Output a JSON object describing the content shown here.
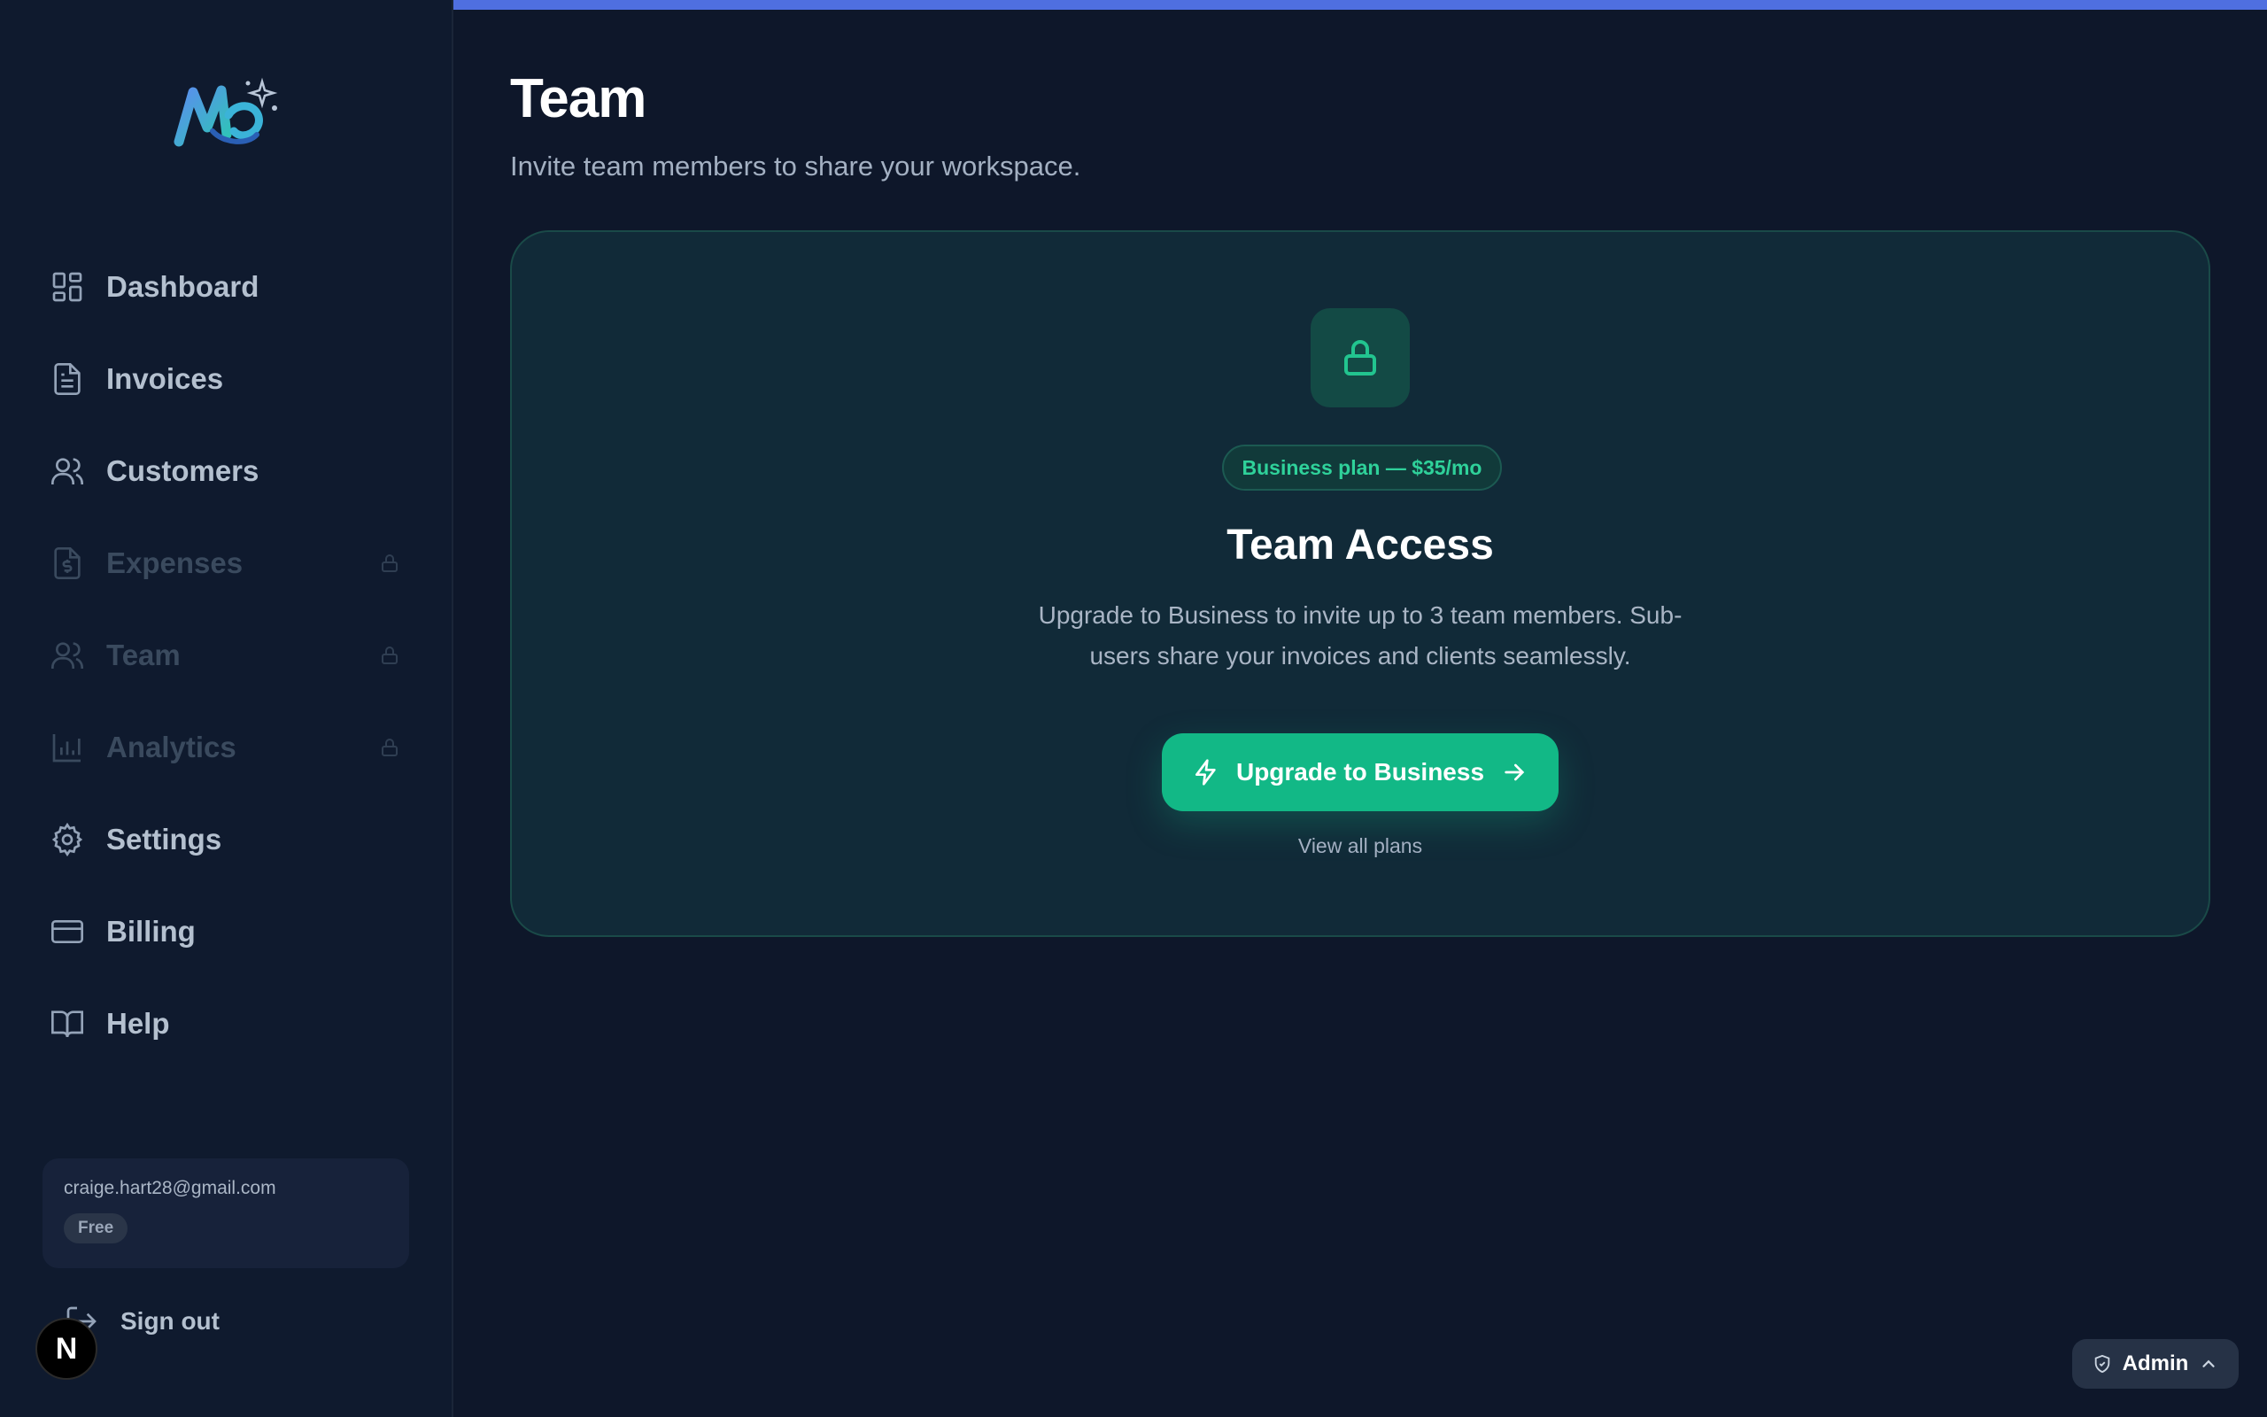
{
  "sidebar": {
    "logo": "mb-logo-icon",
    "items": [
      {
        "label": "Dashboard",
        "icon": "dashboard-icon",
        "locked": false
      },
      {
        "label": "Invoices",
        "icon": "file-text-icon",
        "locked": false
      },
      {
        "label": "Customers",
        "icon": "users-icon",
        "locked": false
      },
      {
        "label": "Expenses",
        "icon": "receipt-icon",
        "locked": true
      },
      {
        "label": "Team",
        "icon": "team-icon",
        "locked": true
      },
      {
        "label": "Analytics",
        "icon": "bar-chart-icon",
        "locked": true
      },
      {
        "label": "Settings",
        "icon": "gear-icon",
        "locked": false
      },
      {
        "label": "Billing",
        "icon": "credit-card-icon",
        "locked": false
      },
      {
        "label": "Help",
        "icon": "book-icon",
        "locked": false
      }
    ],
    "user": {
      "email": "craige.hart28@gmail.com",
      "plan": "Free"
    },
    "signout_label": "Sign out",
    "n_badge": "N"
  },
  "header": {
    "title": "Team",
    "subtitle": "Invite team members to share your workspace."
  },
  "card": {
    "plan_chip": "Business plan — $35/mo",
    "title": "Team Access",
    "description": "Upgrade to Business to invite up to 3 team members. Sub-users share your invoices and clients seamlessly.",
    "upgrade_label": "Upgrade to Business",
    "view_plans_label": "View all plans"
  },
  "admin_label": "Admin",
  "colors": {
    "accent": "#12b886",
    "top_bar": "#4f6fe0",
    "background": "#0e172a",
    "sidebar": "#0f1a2e"
  }
}
